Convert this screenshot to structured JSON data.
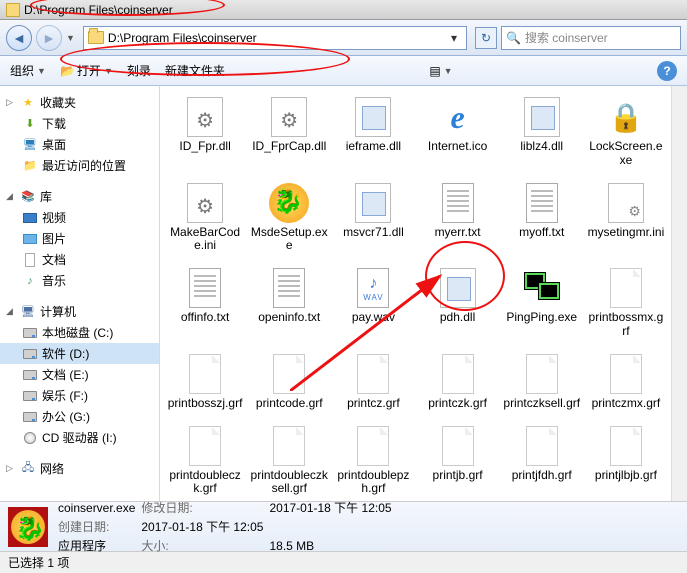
{
  "title_path": "D:\\Program Files\\coinserver",
  "address": "D:\\Program Files\\coinserver",
  "search_placeholder": "搜索 coinserver",
  "toolbar": {
    "organize": "组织",
    "open": "打开",
    "burn": "刻录",
    "newfolder": "新建文件夹"
  },
  "sidebar": {
    "favorites": "收藏夹",
    "fav_items": [
      {
        "label": "下载"
      },
      {
        "label": "桌面"
      },
      {
        "label": "最近访问的位置"
      }
    ],
    "libraries": "库",
    "lib_items": [
      {
        "label": "视频"
      },
      {
        "label": "图片"
      },
      {
        "label": "文档"
      },
      {
        "label": "音乐"
      }
    ],
    "computer": "计算机",
    "drives": [
      {
        "label": "本地磁盘 (C:)"
      },
      {
        "label": "软件 (D:)"
      },
      {
        "label": "文档 (E:)"
      },
      {
        "label": "娱乐 (F:)"
      },
      {
        "label": "办公 (G:)"
      },
      {
        "label": "CD 驱动器 (I:)"
      }
    ],
    "network": "网络"
  },
  "files": [
    {
      "name": "ID_Fpr.dll",
      "icon": "gear"
    },
    {
      "name": "ID_FprCap.dll",
      "icon": "gear"
    },
    {
      "name": "ieframe.dll",
      "icon": "dll"
    },
    {
      "name": "Internet.ico",
      "icon": "ie"
    },
    {
      "name": "liblz4.dll",
      "icon": "dll"
    },
    {
      "name": "LockScreen.exe",
      "icon": "lock"
    },
    {
      "name": "MakeBarCode.ini",
      "icon": "gear"
    },
    {
      "name": "MsdeSetup.exe",
      "icon": "dragon"
    },
    {
      "name": "msvcr71.dll",
      "icon": "dll"
    },
    {
      "name": "myerr.txt",
      "icon": "txt"
    },
    {
      "name": "myoff.txt",
      "icon": "txt"
    },
    {
      "name": "mysetingmr.ini",
      "icon": "ini"
    },
    {
      "name": "offinfo.txt",
      "icon": "txt"
    },
    {
      "name": "openinfo.txt",
      "icon": "txt"
    },
    {
      "name": "pay.wav",
      "icon": "wav"
    },
    {
      "name": "pdh.dll",
      "icon": "dll"
    },
    {
      "name": "PingPing.exe",
      "icon": "ping"
    },
    {
      "name": "printbossmx.grf",
      "icon": "blank"
    },
    {
      "name": "printbosszj.grf",
      "icon": "blank"
    },
    {
      "name": "printcode.grf",
      "icon": "blank"
    },
    {
      "name": "printcz.grf",
      "icon": "blank"
    },
    {
      "name": "printczk.grf",
      "icon": "blank"
    },
    {
      "name": "printczksell.grf",
      "icon": "blank"
    },
    {
      "name": "printczmx.grf",
      "icon": "blank"
    },
    {
      "name": "printdoubleczk.grf",
      "icon": "blank"
    },
    {
      "name": "printdoubleczksell.grf",
      "icon": "blank"
    },
    {
      "name": "printdoublepzh.grf",
      "icon": "blank"
    },
    {
      "name": "printjb.grf",
      "icon": "blank"
    },
    {
      "name": "printjfdh.grf",
      "icon": "blank"
    },
    {
      "name": "printjlbjb.grf",
      "icon": "blank"
    }
  ],
  "details": {
    "name": "coinserver.exe",
    "type": "应用程序",
    "mod_label": "修改日期:",
    "mod_val": "2017-01-18 下午 12:05",
    "create_label": "创建日期:",
    "create_val": "2017-01-18 下午 12:05",
    "size_label": "大小:",
    "size_val": "18.5 MB"
  },
  "status": "已选择 1 项"
}
